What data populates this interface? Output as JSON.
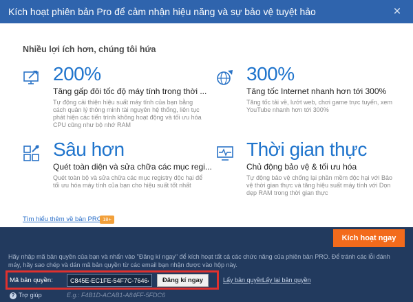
{
  "window": {
    "title": "Kích hoạt phiên bản Pro để cảm nhận hiệu năng và sự bảo vệ tuyệt hảo",
    "close_symbol": "✕"
  },
  "main": {
    "headline": "Nhiều lợi ích hơn, chúng tôi hứa",
    "features": [
      {
        "icon": "rocket-monitor-icon",
        "big": "200%",
        "subtitle": "Tăng gấp đôi tốc độ máy tính trong thời ...",
        "description": "Tự động cải thiện hiệu suất máy tính của bạn bằng cách quản lý thông minh tài nguyên hệ thống, liên tục phát hiện các tiến trình không hoạt động và tối ưu hóa CPU cũng như bộ nhớ RAM"
      },
      {
        "icon": "globe-rocket-icon",
        "big": "300%",
        "subtitle": "Tăng tốc Internet nhanh hơn tới 300%",
        "description": "Tăng tốc tải về, lướt web, chơi game trực tuyến, xem YouTube nhanh hơn tới 300%"
      },
      {
        "icon": "tools-grid-icon",
        "big": "Sâu hơn",
        "subtitle": "Quét toàn diện và sửa chữa các mục regi...",
        "description": "Quét toàn bộ và sửa chữa các mục registry độc hại để tối ưu hóa máy tính của bạn cho hiệu suất tốt nhất"
      },
      {
        "icon": "pulse-monitor-icon",
        "big": "Thời gian thực",
        "subtitle": "Chủ động bảo vệ & tối ưu hóa",
        "description": "Tự động bảo vệ chống lại phần mềm độc hại với Bảo vệ thời gian thực và tăng hiệu suất máy tính với Dọn dẹp RAM trong thời gian thực"
      }
    ],
    "learn_more": "Tìm hiểu thêm về bản PRO",
    "badge": "18+"
  },
  "footer": {
    "activate_button": "Kích hoạt ngay",
    "info_text": "Hãy nhập mã bản quyền của bạn và nhấn vào \"Đăng kí ngay\" để kích hoạt tất cả các chức năng của phiên bản PRO. Để tránh các lỗi đánh máy, hãy sao chép và dán mã bản quyền từ các email bạn nhận được vào hộp này.",
    "license_label": "Mã bản quyền:",
    "license_value": "C845E-EC1FE-54F7C-76464",
    "register_button": "Đăng kí ngay",
    "get_license_link": "Lấy bản quyền",
    "retrieve_license_link": "Lấy lại bản quyền",
    "help": "Trợ giúp",
    "example": "E.g.: F4B1D-ACAB1-A84FF-5FDC6"
  },
  "colors": {
    "title_bar": "#2f64ad",
    "accent_blue": "#1f74cc",
    "orange": "#f36b1c",
    "highlight_red": "#e0312e",
    "dark_bg": "#223a5e"
  }
}
